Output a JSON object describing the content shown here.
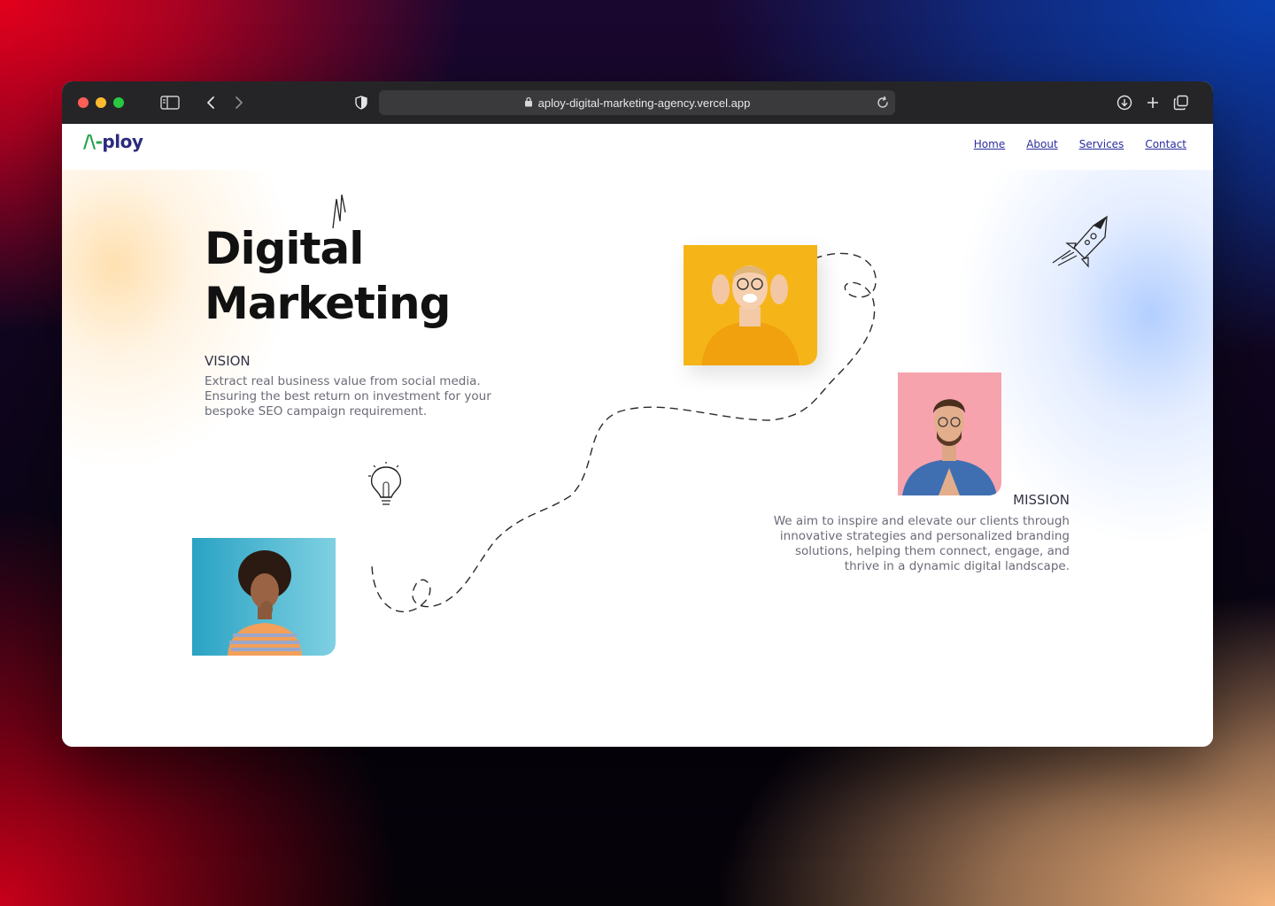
{
  "browser": {
    "url": "aploy-digital-marketing-agency.vercel.app",
    "icons": [
      "sidebar-icon",
      "back-icon",
      "forward-icon",
      "shield-icon",
      "lock-icon",
      "reload-icon",
      "download-icon",
      "new-tab-icon",
      "tabs-overview-icon"
    ]
  },
  "site": {
    "logo": {
      "mark": "/\\-",
      "text": "ploy"
    },
    "nav": [
      {
        "label": "Home"
      },
      {
        "label": "About"
      },
      {
        "label": "Services"
      },
      {
        "label": "Contact"
      }
    ],
    "hero": {
      "title_line1": "Digital",
      "title_line2": "Marketing"
    },
    "vision": {
      "heading": "VISION",
      "text": "Extract real business value from social media. Ensuring the best return on investment for your bespoke SEO campaign requirement."
    },
    "mission": {
      "heading": "MISSION",
      "text": "We aim to inspire and elevate our clients through innovative strategies and personalized branding solutions, helping them connect, engage, and thrive in a dynamic digital landscape."
    },
    "photos": [
      {
        "name": "woman-yellow-sweater-photo",
        "bg": "#f5b518"
      },
      {
        "name": "man-pink-background-photo",
        "bg": "#f6a3ad"
      },
      {
        "name": "woman-blue-background-photo",
        "bg": "#3fb3cf"
      }
    ],
    "colors": {
      "nav_link": "#2b2d9c",
      "logo_text": "#2b2b7e",
      "logo_mark": "#22a34a"
    }
  }
}
